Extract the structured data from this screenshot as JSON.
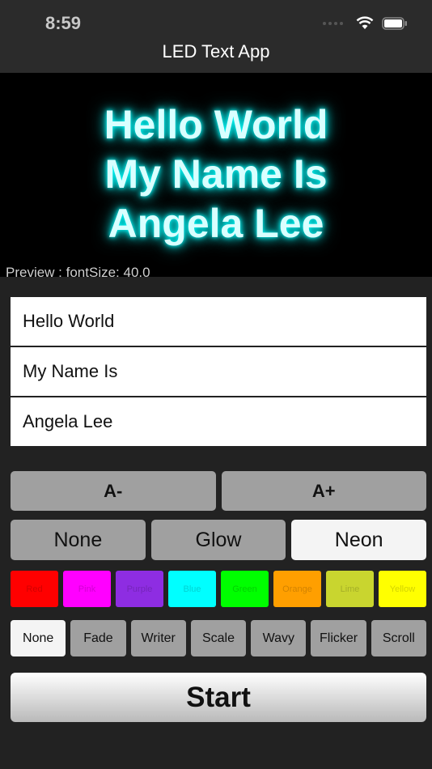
{
  "status_bar": {
    "time": "8:59"
  },
  "nav": {
    "title": "LED Text App"
  },
  "preview": {
    "lines": [
      "Hello World",
      "My Name Is",
      "Angela Lee"
    ],
    "label": "Preview : fontSize: 40.0",
    "glow_color": "#00ffff"
  },
  "inputs": [
    "Hello World",
    "My Name Is",
    "Angela Lee"
  ],
  "size_buttons": {
    "decrease": "A-",
    "increase": "A+"
  },
  "effects": [
    {
      "label": "None",
      "selected": false
    },
    {
      "label": "Glow",
      "selected": false
    },
    {
      "label": "Neon",
      "selected": true
    }
  ],
  "colors": [
    {
      "label": "Red",
      "color": "#ff0000"
    },
    {
      "label": "Pink",
      "color": "#ff00ff"
    },
    {
      "label": "Purple",
      "color": "#8e2de2"
    },
    {
      "label": "Blue",
      "color": "#00ffff"
    },
    {
      "label": "Green",
      "color": "#00ff00"
    },
    {
      "label": "Orange",
      "color": "#ff9f00"
    },
    {
      "label": "Lime",
      "color": "#c9d52f"
    },
    {
      "label": "Yellow",
      "color": "#ffff00"
    }
  ],
  "animations": [
    {
      "label": "None",
      "selected": true
    },
    {
      "label": "Fade",
      "selected": false
    },
    {
      "label": "Writer",
      "selected": false
    },
    {
      "label": "Scale",
      "selected": false
    },
    {
      "label": "Wavy",
      "selected": false
    },
    {
      "label": "Flicker",
      "selected": false
    },
    {
      "label": "Scroll",
      "selected": false
    }
  ],
  "start_label": "Start"
}
